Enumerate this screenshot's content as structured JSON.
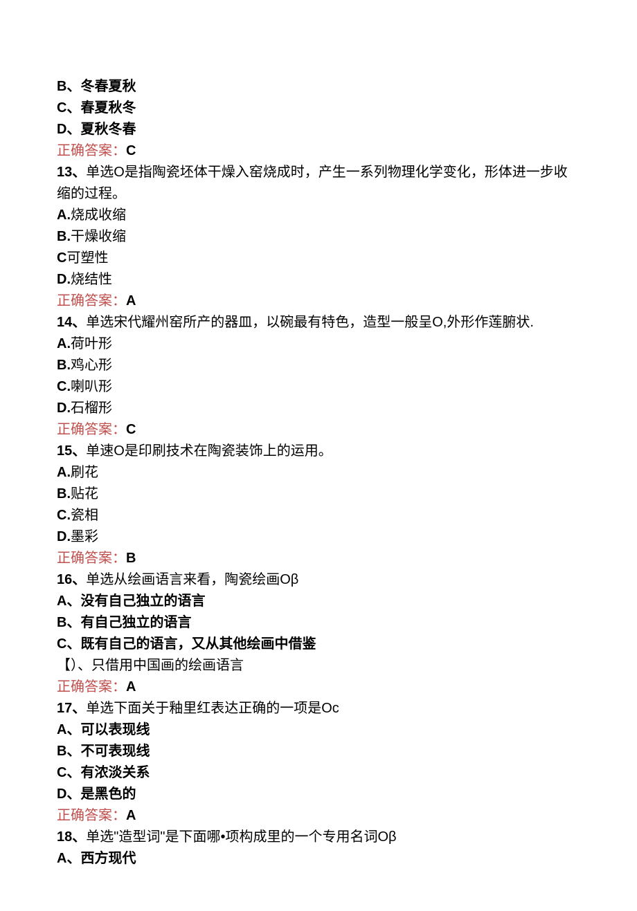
{
  "lines": [
    {
      "text": "B、冬春夏秋",
      "class": "bold"
    },
    {
      "text": "C、春夏秋冬",
      "class": "bold"
    },
    {
      "text": "D、夏秋冬春",
      "class": "bold"
    },
    {
      "parts": [
        {
          "text": "正确答案：",
          "class": "answer"
        },
        {
          "text": "C",
          "class": "bold"
        }
      ]
    },
    {
      "parts": [
        {
          "text": "13、",
          "class": "bold"
        },
        {
          "text": "单选O是指陶瓷坯体干燥入窑烧成时，产生一系列物理化学变化，形体进一步收缩的过程。",
          "class": ""
        }
      ]
    },
    {
      "parts": [
        {
          "text": "A.",
          "class": "bold"
        },
        {
          "text": "烧成收缩",
          "class": ""
        }
      ]
    },
    {
      "parts": [
        {
          "text": "B.",
          "class": "bold"
        },
        {
          "text": "干燥收缩",
          "class": ""
        }
      ]
    },
    {
      "parts": [
        {
          "text": "C",
          "class": "bold"
        },
        {
          "text": "可塑性",
          "class": ""
        }
      ]
    },
    {
      "parts": [
        {
          "text": "D.",
          "class": "bold"
        },
        {
          "text": "烧结性",
          "class": ""
        }
      ]
    },
    {
      "parts": [
        {
          "text": "正确答案：",
          "class": "answer"
        },
        {
          "text": "A",
          "class": "bold"
        }
      ]
    },
    {
      "parts": [
        {
          "text": "14、",
          "class": "bold"
        },
        {
          "text": "单选宋代耀州窑所产的器皿，以碗最有特色，造型一般呈O,外形作莲腑状.",
          "class": ""
        }
      ]
    },
    {
      "parts": [
        {
          "text": "A.",
          "class": "bold"
        },
        {
          "text": "荷叶形",
          "class": ""
        }
      ]
    },
    {
      "parts": [
        {
          "text": "B.",
          "class": "bold"
        },
        {
          "text": "鸡心形",
          "class": ""
        }
      ]
    },
    {
      "parts": [
        {
          "text": "C.",
          "class": "bold"
        },
        {
          "text": "喇叭形",
          "class": ""
        }
      ]
    },
    {
      "parts": [
        {
          "text": "D.",
          "class": "bold"
        },
        {
          "text": "石榴形",
          "class": ""
        }
      ]
    },
    {
      "parts": [
        {
          "text": "正确答案：",
          "class": "answer"
        },
        {
          "text": "C",
          "class": "bold"
        }
      ]
    },
    {
      "parts": [
        {
          "text": "15、",
          "class": "bold"
        },
        {
          "text": "单速O是印刷技术在陶瓷装饰上的运用。",
          "class": ""
        }
      ]
    },
    {
      "parts": [
        {
          "text": "A.",
          "class": "bold"
        },
        {
          "text": "刷花",
          "class": ""
        }
      ]
    },
    {
      "parts": [
        {
          "text": "B.",
          "class": "bold"
        },
        {
          "text": "贴花",
          "class": ""
        }
      ]
    },
    {
      "parts": [
        {
          "text": "C.",
          "class": "bold"
        },
        {
          "text": "瓷相",
          "class": ""
        }
      ]
    },
    {
      "parts": [
        {
          "text": "D.",
          "class": "bold"
        },
        {
          "text": "墨彩",
          "class": ""
        }
      ]
    },
    {
      "parts": [
        {
          "text": "正确答案：",
          "class": "answer"
        },
        {
          "text": "B",
          "class": "bold"
        }
      ]
    },
    {
      "parts": [
        {
          "text": "16、",
          "class": "bold"
        },
        {
          "text": "单选从绘画语言来看，陶瓷绘画Oβ",
          "class": ""
        }
      ]
    },
    {
      "text": "A、没有自己独立的语言",
      "class": "bold"
    },
    {
      "text": "B、有自己独立的语言",
      "class": "bold"
    },
    {
      "text": "C、既有自己的语言，又从其他绘画中借鉴",
      "class": "bold"
    },
    {
      "text": "【）、只借用中国画的绘画语言",
      "class": ""
    },
    {
      "parts": [
        {
          "text": "正确答案：",
          "class": "answer"
        },
        {
          "text": "A",
          "class": "bold"
        }
      ]
    },
    {
      "parts": [
        {
          "text": "17、",
          "class": "bold"
        },
        {
          "text": "单选下面关于釉里红表达正确的一项是Oc",
          "class": ""
        }
      ]
    },
    {
      "text": "A、可以表现线",
      "class": "bold"
    },
    {
      "text": "B、不可表现线",
      "class": "bold"
    },
    {
      "text": "C、有浓淡关系",
      "class": "bold"
    },
    {
      "text": "D、是黑色的",
      "class": "bold"
    },
    {
      "parts": [
        {
          "text": "正确答案：",
          "class": "answer"
        },
        {
          "text": "A",
          "class": "bold"
        }
      ]
    },
    {
      "parts": [
        {
          "text": "18、",
          "class": "bold"
        },
        {
          "text": "单选\"造型词\"是下面哪•项构成里的一个专用名词Oβ",
          "class": ""
        }
      ]
    },
    {
      "text": "A、西方现代",
      "class": "bold"
    }
  ]
}
